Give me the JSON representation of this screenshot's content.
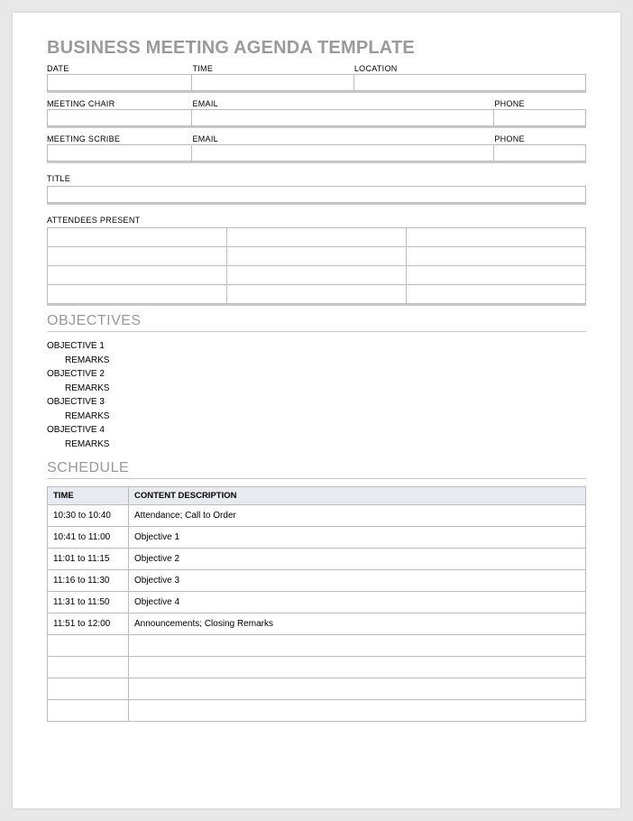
{
  "title": "BUSINESS MEETING AGENDA TEMPLATE",
  "meta1": {
    "date_label": "DATE",
    "date_value": "",
    "time_label": "TIME",
    "time_value": "",
    "location_label": "LOCATION",
    "location_value": ""
  },
  "chair": {
    "label": "MEETING CHAIR",
    "value": "",
    "email_label": "EMAIL",
    "email_value": "",
    "phone_label": "PHONE",
    "phone_value": ""
  },
  "scribe": {
    "label": "MEETING SCRIBE",
    "value": "",
    "email_label": "EMAIL",
    "email_value": "",
    "phone_label": "PHONE",
    "phone_value": ""
  },
  "title_field": {
    "label": "TITLE",
    "value": ""
  },
  "attendees": {
    "label": "ATTENDEES PRESENT",
    "rows": 4,
    "cols": 3
  },
  "objectives": {
    "heading": "OBJECTIVES",
    "items": [
      {
        "obj": "OBJECTIVE 1",
        "rem": "REMARKS"
      },
      {
        "obj": "OBJECTIVE 2",
        "rem": "REMARKS"
      },
      {
        "obj": "OBJECTIVE 3",
        "rem": "REMARKS"
      },
      {
        "obj": "OBJECTIVE 4",
        "rem": "REMARKS"
      }
    ]
  },
  "schedule": {
    "heading": "SCHEDULE",
    "headers": {
      "time": "TIME",
      "content": "CONTENT DESCRIPTION"
    },
    "rows": [
      {
        "time": "10:30 to 10:40",
        "content": "Attendance; Call to Order"
      },
      {
        "time": "10:41 to 11:00",
        "content": "Objective 1"
      },
      {
        "time": "11:01 to 11:15",
        "content": "Objective 2"
      },
      {
        "time": "11:16 to 11:30",
        "content": "Objective 3"
      },
      {
        "time": "11:31 to 11:50",
        "content": "Objective 4"
      },
      {
        "time": "11:51 to 12:00",
        "content": "Announcements; Closing Remarks"
      },
      {
        "time": "",
        "content": ""
      },
      {
        "time": "",
        "content": ""
      },
      {
        "time": "",
        "content": ""
      },
      {
        "time": "",
        "content": ""
      }
    ]
  }
}
